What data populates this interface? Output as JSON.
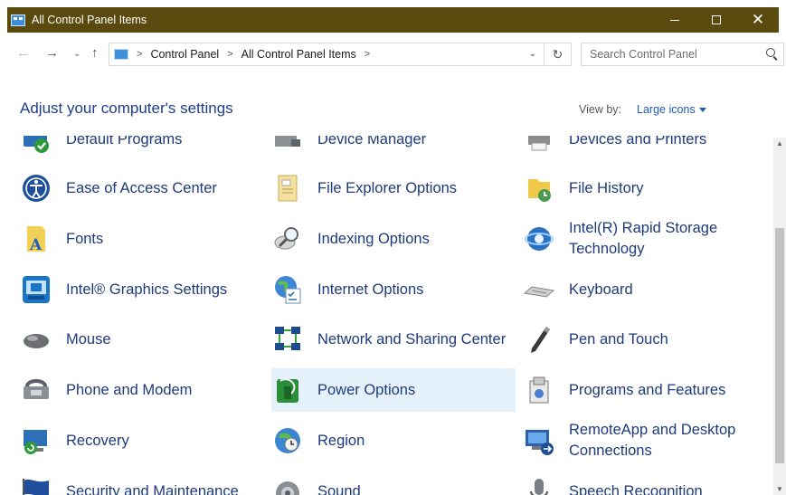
{
  "window": {
    "title": "All Control Panel Items",
    "close_glyph": "✕"
  },
  "nav": {
    "back": "←",
    "forward": "→",
    "recent": "⌄",
    "up": "↑",
    "breadcrumb": [
      "Control Panel",
      "All Control Panel Items"
    ],
    "refresh": "↻",
    "search_placeholder": "Search Control Panel"
  },
  "header": {
    "title": "Adjust your computer's settings",
    "view_by_label": "View by:",
    "view_by_value": "Large icons"
  },
  "items": [
    {
      "label": "Default Programs",
      "col": 0,
      "row": 0,
      "icon": "default-programs-icon"
    },
    {
      "label": "Device Manager",
      "col": 1,
      "row": 0,
      "icon": "device-manager-icon"
    },
    {
      "label": "Devices and Printers",
      "col": 2,
      "row": 0,
      "icon": "printer-icon"
    },
    {
      "label": "Ease of Access Center",
      "col": 0,
      "row": 1,
      "icon": "ease-of-access-icon"
    },
    {
      "label": "File Explorer Options",
      "col": 1,
      "row": 1,
      "icon": "folder-options-icon"
    },
    {
      "label": "File History",
      "col": 2,
      "row": 1,
      "icon": "file-history-icon"
    },
    {
      "label": "Fonts",
      "col": 0,
      "row": 2,
      "icon": "fonts-icon"
    },
    {
      "label": "Indexing Options",
      "col": 1,
      "row": 2,
      "icon": "indexing-icon"
    },
    {
      "label": "Intel(R) Rapid Storage Technology",
      "col": 2,
      "row": 2,
      "icon": "rapid-storage-icon"
    },
    {
      "label": "Intel® Graphics Settings",
      "col": 0,
      "row": 3,
      "icon": "intel-graphics-icon"
    },
    {
      "label": "Internet Options",
      "col": 1,
      "row": 3,
      "icon": "internet-options-icon"
    },
    {
      "label": "Keyboard",
      "col": 2,
      "row": 3,
      "icon": "keyboard-icon"
    },
    {
      "label": "Mouse",
      "col": 0,
      "row": 4,
      "icon": "mouse-icon"
    },
    {
      "label": "Network and Sharing Center",
      "col": 1,
      "row": 4,
      "icon": "network-icon"
    },
    {
      "label": "Pen and Touch",
      "col": 2,
      "row": 4,
      "icon": "pen-icon"
    },
    {
      "label": "Phone and Modem",
      "col": 0,
      "row": 5,
      "icon": "phone-modem-icon"
    },
    {
      "label": "Power Options",
      "col": 1,
      "row": 5,
      "icon": "power-options-icon",
      "highlighted": true
    },
    {
      "label": "Programs and Features",
      "col": 2,
      "row": 5,
      "icon": "programs-features-icon"
    },
    {
      "label": "Recovery",
      "col": 0,
      "row": 6,
      "icon": "recovery-icon"
    },
    {
      "label": "Region",
      "col": 1,
      "row": 6,
      "icon": "region-icon"
    },
    {
      "label": "RemoteApp and Desktop Connections",
      "col": 2,
      "row": 6,
      "icon": "remoteapp-icon"
    },
    {
      "label": "Security and Maintenance",
      "col": 0,
      "row": 7,
      "icon": "security-flag-icon"
    },
    {
      "label": "Sound",
      "col": 1,
      "row": 7,
      "icon": "sound-icon"
    },
    {
      "label": "Speech Recognition",
      "col": 2,
      "row": 7,
      "icon": "microphone-icon"
    }
  ],
  "colors": {
    "titlebar": "#5b4a0e",
    "link": "#1e3a7a",
    "highlight": "#e6f2fb"
  }
}
